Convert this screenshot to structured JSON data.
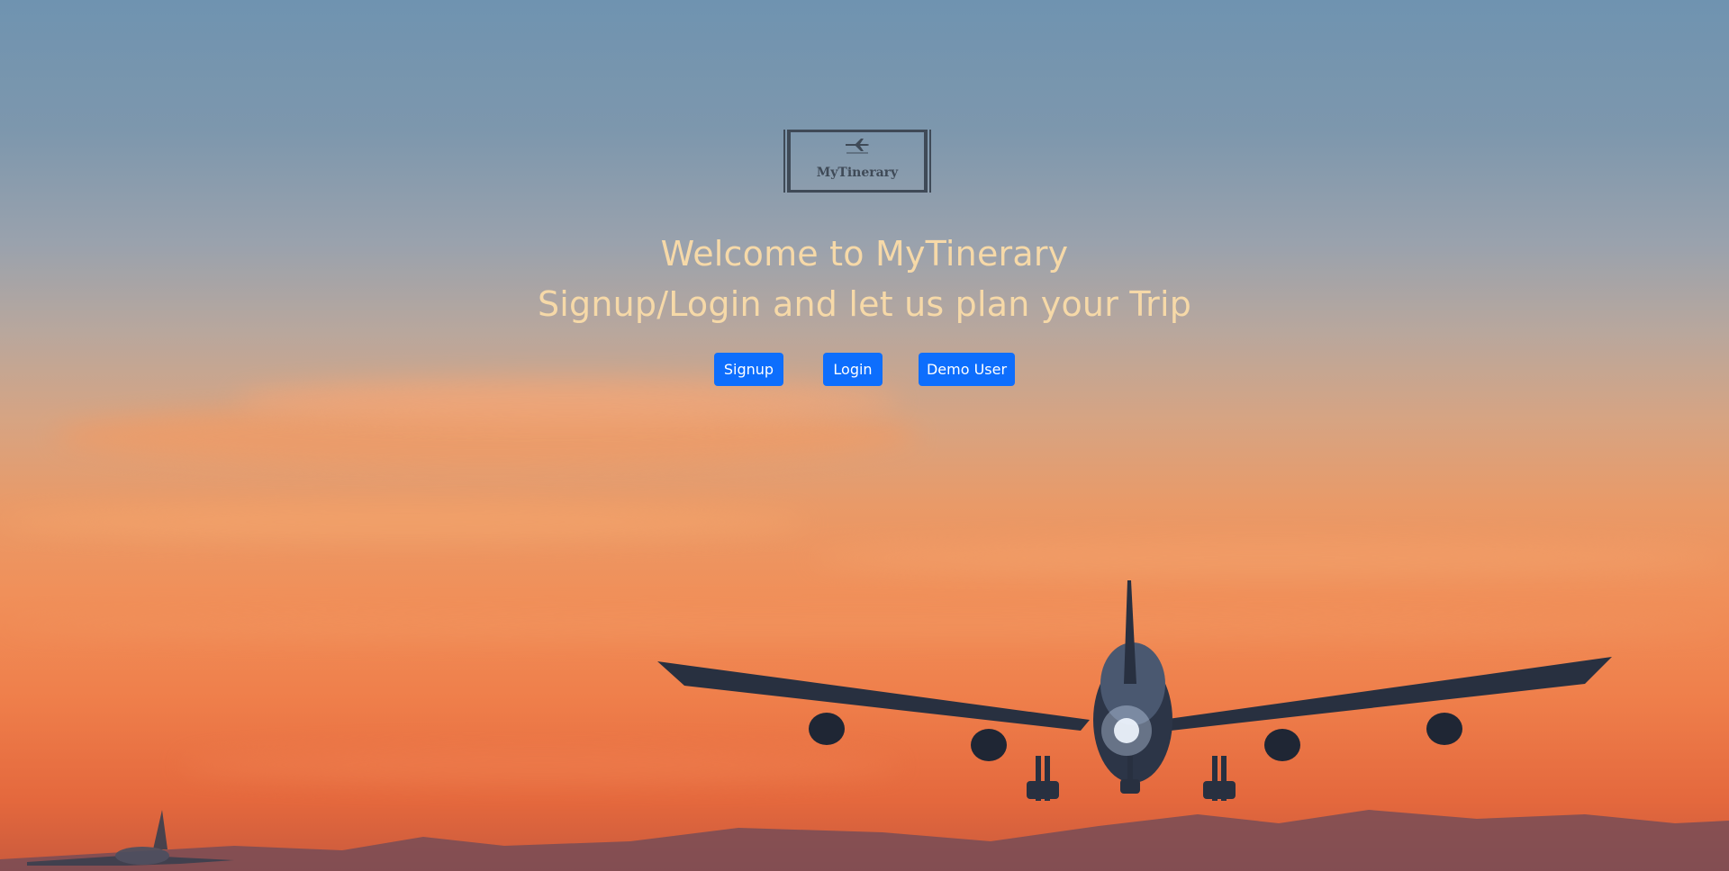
{
  "logo": {
    "text": "MyTinerary",
    "icon": "airplane-icon"
  },
  "hero": {
    "title": "Welcome to MyTinerary",
    "subtitle": "Signup/Login and let us plan your Trip"
  },
  "actions": {
    "signup_label": "Signup",
    "login_label": "Login",
    "demo_label": "Demo User"
  },
  "colors": {
    "primary_button": "#0d6efd",
    "headline": "#f6d9a8",
    "logo": "#3f4a57"
  }
}
